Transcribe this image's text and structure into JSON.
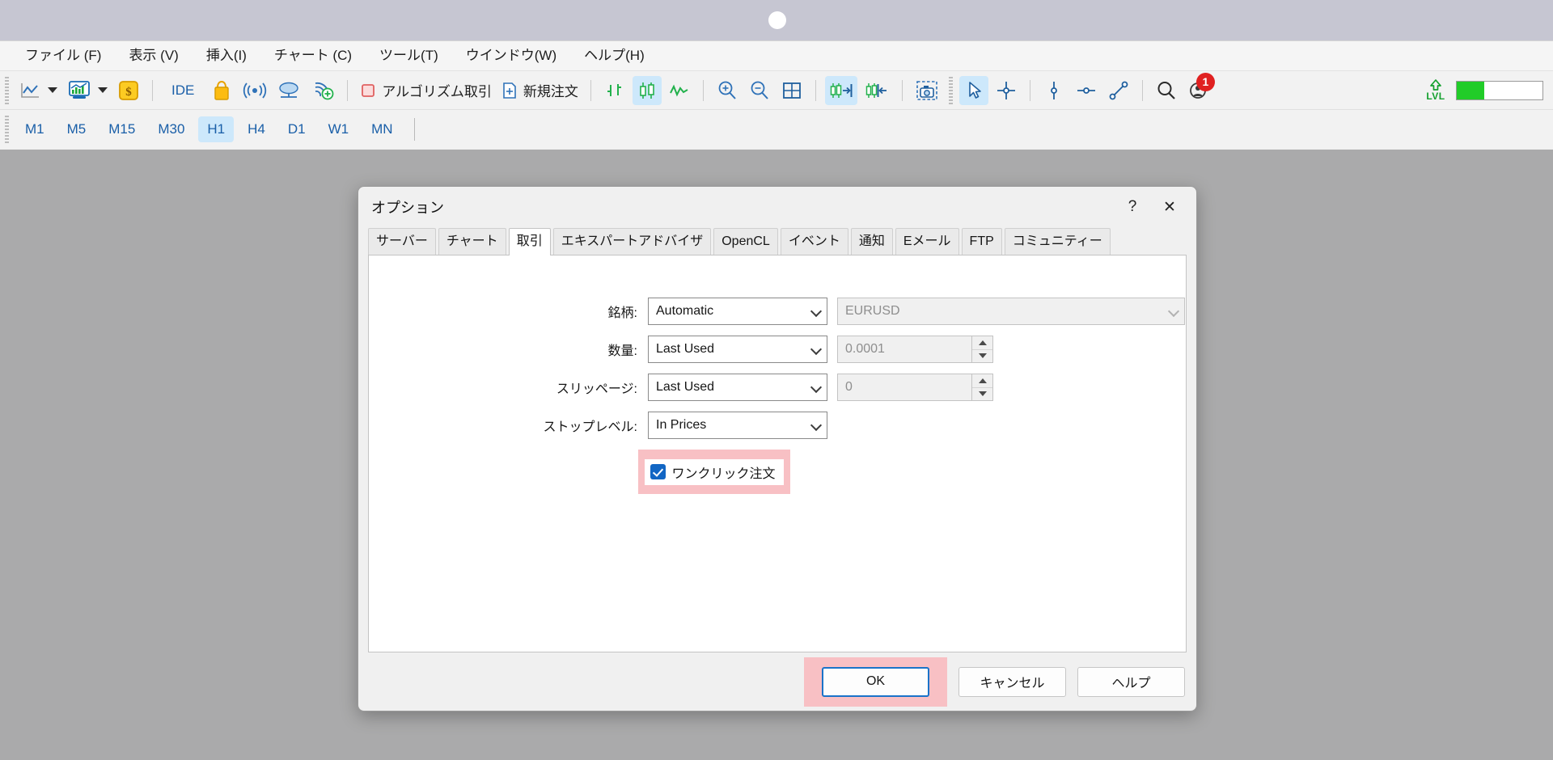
{
  "window": {
    "notch_icon": "camera-notch-dot"
  },
  "menubar": {
    "items": [
      {
        "label": "ファイル (F)",
        "name": "menu-file"
      },
      {
        "label": "表示 (V)",
        "name": "menu-view"
      },
      {
        "label": "挿入(I)",
        "name": "menu-insert"
      },
      {
        "label": "チャート (C)",
        "name": "menu-chart"
      },
      {
        "label": "ツール(T)",
        "name": "menu-tools"
      },
      {
        "label": "ウインドウ(W)",
        "name": "menu-window"
      },
      {
        "label": "ヘルプ(H)",
        "name": "menu-help"
      }
    ]
  },
  "toolbar": {
    "ide_label": "IDE",
    "algo_label": "アルゴリズム取引",
    "neworder_label": "新規注文",
    "lvl_label": "LVL",
    "notification_count": "1",
    "progress_percent": 32,
    "icons": [
      "line-chart-icon",
      "chart-dropdown-caret",
      "indicators-icon",
      "indicators-dropdown-caret",
      "dollar-coin-icon",
      "ide-icon",
      "market-bag-icon",
      "signals-icon",
      "vps-cloud-icon",
      "add-signal-icon",
      "algo-trading-stop-icon",
      "new-order-icon",
      "bar-chart-icon",
      "candlestick-icon",
      "line-mode-icon",
      "zoom-in-icon",
      "zoom-out-icon",
      "grid-icon",
      "auto-scroll-icon",
      "chart-shift-icon",
      "screenshot-icon",
      "cursor-icon",
      "crosshair-icon",
      "vertical-line-icon",
      "horizontal-line-icon",
      "trendline-icon",
      "search-icon",
      "notifications-icon",
      "lvl-icon",
      "progress-bar"
    ]
  },
  "timeframes": {
    "items": [
      "M1",
      "M5",
      "M15",
      "M30",
      "H1",
      "H4",
      "D1",
      "W1",
      "MN"
    ],
    "active": "H1"
  },
  "dialog": {
    "title": "オプション",
    "help_button": "?",
    "close_button": "✕",
    "tabs": [
      {
        "label": "サーバー",
        "name": "tab-server"
      },
      {
        "label": "チャート",
        "name": "tab-charts"
      },
      {
        "label": "取引",
        "name": "tab-trade"
      },
      {
        "label": "エキスパートアドバイザ",
        "name": "tab-expert-advisors"
      },
      {
        "label": "OpenCL",
        "name": "tab-opencl"
      },
      {
        "label": "イベント",
        "name": "tab-events"
      },
      {
        "label": "通知",
        "name": "tab-notifications"
      },
      {
        "label": "Eメール",
        "name": "tab-email"
      },
      {
        "label": "FTP",
        "name": "tab-ftp"
      },
      {
        "label": "コミュニティー",
        "name": "tab-community"
      }
    ],
    "active_tab": "取引",
    "form": {
      "symbol": {
        "label": "銘柄:",
        "mode_value": "Automatic",
        "symbol_value": "EURUSD"
      },
      "volume": {
        "label": "数量:",
        "mode_value": "Last Used",
        "amount_value": "0.0001"
      },
      "slippage": {
        "label": "スリッページ:",
        "mode_value": "Last Used",
        "amount_value": "0"
      },
      "stoplevels": {
        "label": "ストップレベル:",
        "mode_value": "In Prices"
      },
      "oneclick": {
        "label": "ワンクリック注文",
        "checked": true
      }
    },
    "buttons": {
      "ok": "OK",
      "cancel": "キャンセル",
      "help": "ヘルプ"
    }
  },
  "colors": {
    "desktop_background": "#aaaaab",
    "notch_bar": "#c6c6d2",
    "accent_blue": "#1a5fa8",
    "tab_active_bg": "#cde8fb",
    "highlight_pink": "#f8c0c4",
    "checkbox_blue": "#1266c4",
    "progress_green": "#21cc28",
    "badge_red": "#e02020"
  }
}
